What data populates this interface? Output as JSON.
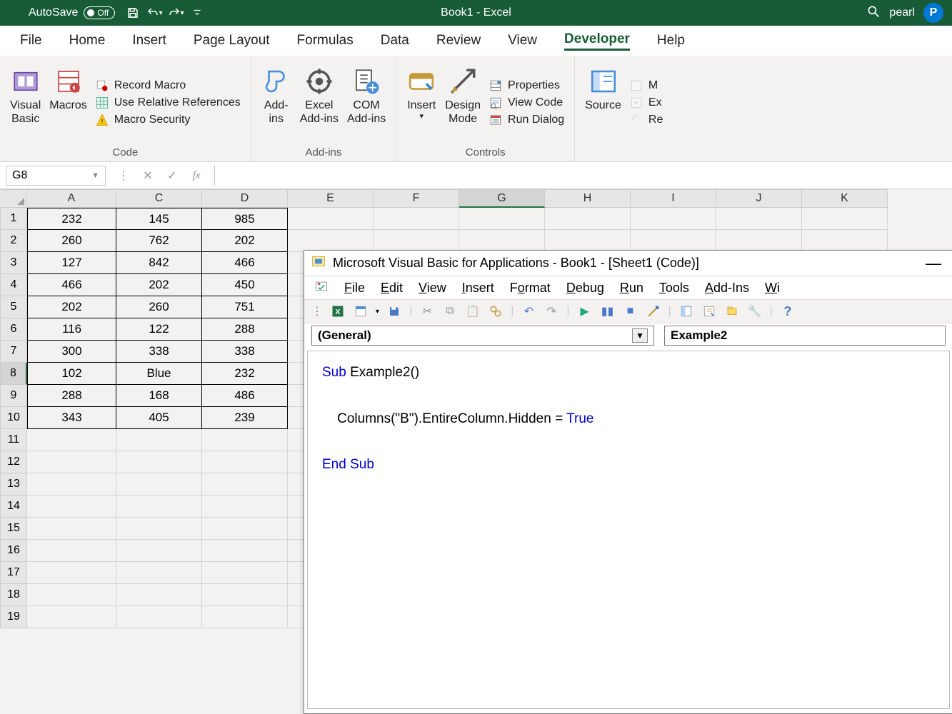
{
  "title_bar": {
    "autosave": "AutoSave",
    "autosave_state": "Off",
    "title": "Book1 - Excel",
    "user": "pearl",
    "avatar": "P"
  },
  "tabs": [
    "File",
    "Home",
    "Insert",
    "Page Layout",
    "Formulas",
    "Data",
    "Review",
    "View",
    "Developer",
    "Help"
  ],
  "active_tab": "Developer",
  "ribbon": {
    "code": {
      "visual_basic": "Visual\nBasic",
      "macros": "Macros",
      "record": "Record Macro",
      "relative": "Use Relative References",
      "security": "Macro Security",
      "label": "Code"
    },
    "addins": {
      "addins": "Add-\nins",
      "excel": "Excel\nAdd-ins",
      "com": "COM\nAdd-ins",
      "label": "Add-ins"
    },
    "controls": {
      "insert": "Insert",
      "design": "Design\nMode",
      "properties": "Properties",
      "viewcode": "View Code",
      "rundialog": "Run Dialog",
      "label": "Controls"
    },
    "xml": {
      "source": "Source",
      "m": "M",
      "ex": "Ex",
      "re": "Re"
    }
  },
  "namebox": "G8",
  "columns": [
    "A",
    "C",
    "D",
    "E",
    "F",
    "G",
    "H",
    "I",
    "J",
    "K"
  ],
  "data_cols": 3,
  "sel_col": "G",
  "sel_row": 8,
  "rows": [
    [
      "232",
      "145",
      "985"
    ],
    [
      "260",
      "762",
      "202"
    ],
    [
      "127",
      "842",
      "466"
    ],
    [
      "466",
      "202",
      "450"
    ],
    [
      "202",
      "260",
      "751"
    ],
    [
      "116",
      "122",
      "288"
    ],
    [
      "300",
      "338",
      "338"
    ],
    [
      "102",
      "Blue",
      "232"
    ],
    [
      "288",
      "168",
      "486"
    ],
    [
      "343",
      "405",
      "239"
    ]
  ],
  "empty_rows": 9,
  "col_widths": {
    "data": 120,
    "blank": 120
  },
  "vba": {
    "title": "Microsoft Visual Basic for Applications - Book1 - [Sheet1 (Code)]",
    "menu": [
      "File",
      "Edit",
      "View",
      "Insert",
      "Format",
      "Debug",
      "Run",
      "Tools",
      "Add-Ins",
      "Wi"
    ],
    "dd1": "(General)",
    "dd2": "Example2",
    "code_lines": [
      {
        "t": "Sub ",
        "k": true
      },
      {
        "t": "Example2()\n\n    Columns("
      },
      {
        "t": "\"B\"",
        "k": false
      },
      {
        "t": ").EntireColumn.Hidden = "
      },
      {
        "t": "True",
        "k": true
      },
      {
        "t": "\n\n"
      },
      {
        "t": "End Sub",
        "k": true
      }
    ]
  }
}
